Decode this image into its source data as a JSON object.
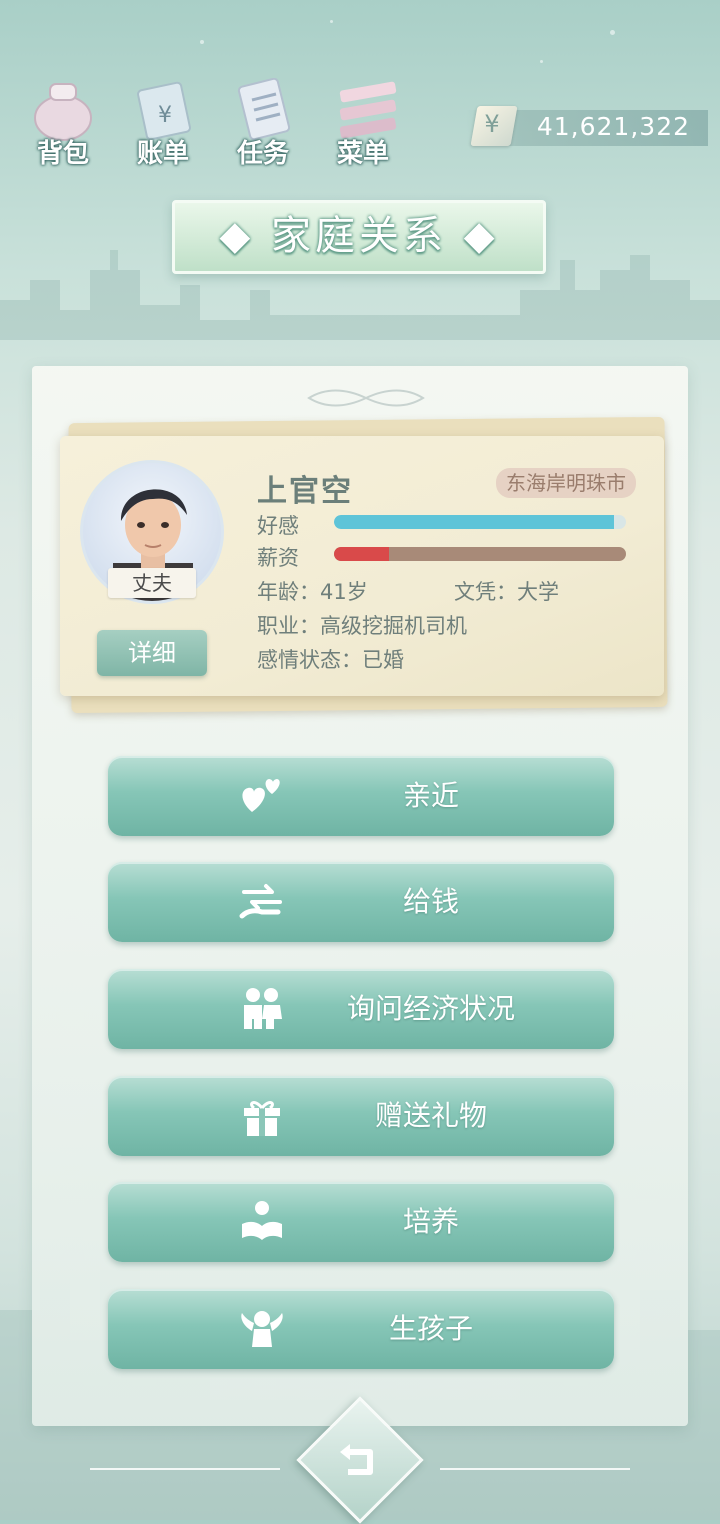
{
  "nav": [
    {
      "label": "背包",
      "icon": "bag-icon"
    },
    {
      "label": "账单",
      "icon": "bill-icon"
    },
    {
      "label": "任务",
      "icon": "task-icon"
    },
    {
      "label": "菜单",
      "icon": "menu-icon"
    }
  ],
  "money": {
    "symbol": "¥",
    "value": "41,621,322"
  },
  "title": "◆ 家庭关系 ◆",
  "profile": {
    "role": "丈夫",
    "detail_button": "详细",
    "name": "上官空",
    "city": "东海岸明珠市",
    "affection_label": "好感",
    "affection_level": 0.96,
    "salary_label": "薪资",
    "salary_level": 0.19,
    "age": "年龄：41岁",
    "education": "文凭：大学",
    "job": "职业：高级挖掘机司机",
    "relationship": "感情状态：已婚"
  },
  "actions": [
    {
      "label": "亲近",
      "icon": "hearts-icon"
    },
    {
      "label": "给钱",
      "icon": "give-money-icon"
    },
    {
      "label": "询问经济状况",
      "icon": "couple-icon"
    },
    {
      "label": "赠送礼物",
      "icon": "gift-icon"
    },
    {
      "label": "培养",
      "icon": "study-icon"
    },
    {
      "label": "生孩子",
      "icon": "angel-icon"
    }
  ],
  "colors": {
    "affection": "#5ec4d8",
    "salary": "#d94a4a",
    "salary_track": "#a88a78",
    "button": "#7fbfb0"
  }
}
